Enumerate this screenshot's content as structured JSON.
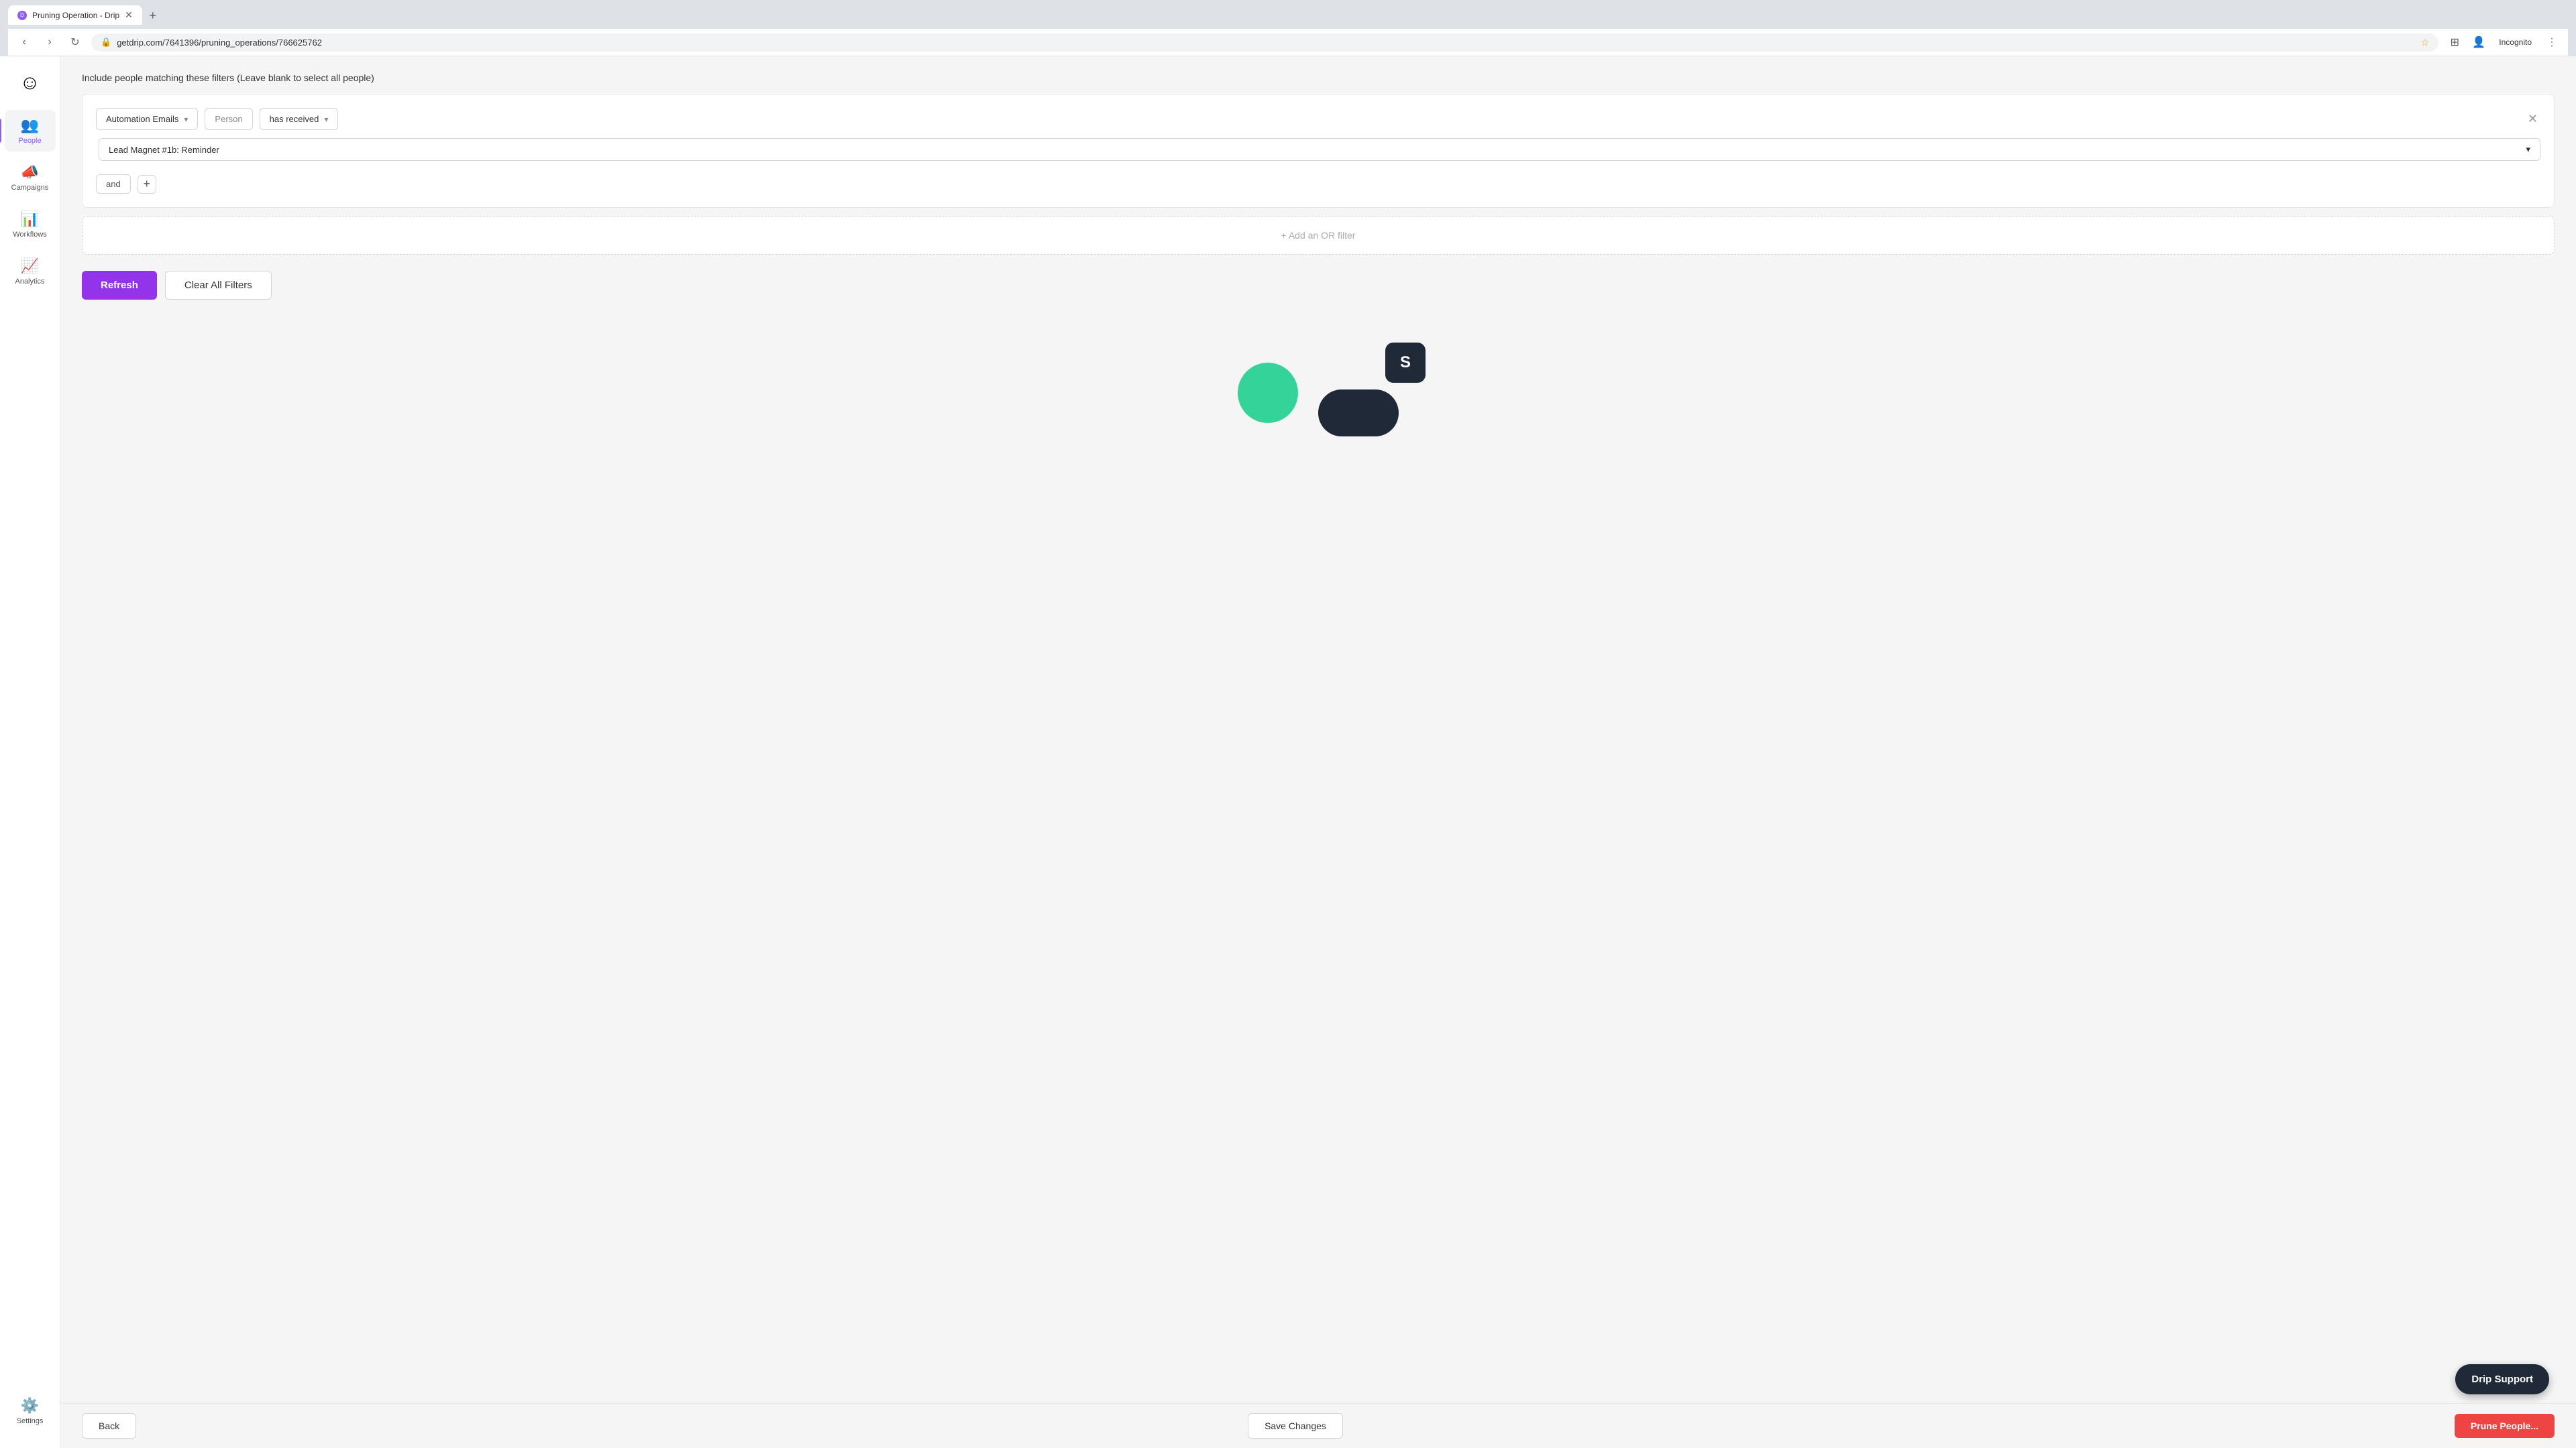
{
  "browser": {
    "tab_title": "Pruning Operation - Drip",
    "url": "getdrip.com/7641396/pruning_operations/766625762",
    "incognito_label": "Incognito"
  },
  "sidebar": {
    "logo_emoji": "☺",
    "items": [
      {
        "id": "people",
        "label": "People",
        "icon": "👥",
        "active": true
      },
      {
        "id": "campaigns",
        "label": "Campaigns",
        "icon": "📣",
        "active": false
      },
      {
        "id": "workflows",
        "label": "Workflows",
        "icon": "📊",
        "active": false
      },
      {
        "id": "analytics",
        "label": "Analytics",
        "icon": "📈",
        "active": false
      },
      {
        "id": "settings",
        "label": "Settings",
        "icon": "⚙️",
        "active": false
      }
    ]
  },
  "page": {
    "filter_header": "Include people matching these filters (Leave blank to select all people)",
    "filter": {
      "type_label": "Automation Emails",
      "person_label": "Person",
      "condition_label": "has received",
      "value_label": "Lead Magnet #1b: Reminder",
      "and_label": "and",
      "add_or_filter_label": "+ Add an OR filter"
    },
    "buttons": {
      "refresh_label": "Refresh",
      "clear_filters_label": "Clear All Filters",
      "back_label": "Back",
      "save_changes_label": "Save Changes",
      "prune_people_label": "Prune People..."
    },
    "drip_support": {
      "label": "Drip Support"
    }
  },
  "colors": {
    "purple": "#9333ea",
    "red": "#ef4444",
    "dark": "#1f2937",
    "green": "#34d399"
  }
}
